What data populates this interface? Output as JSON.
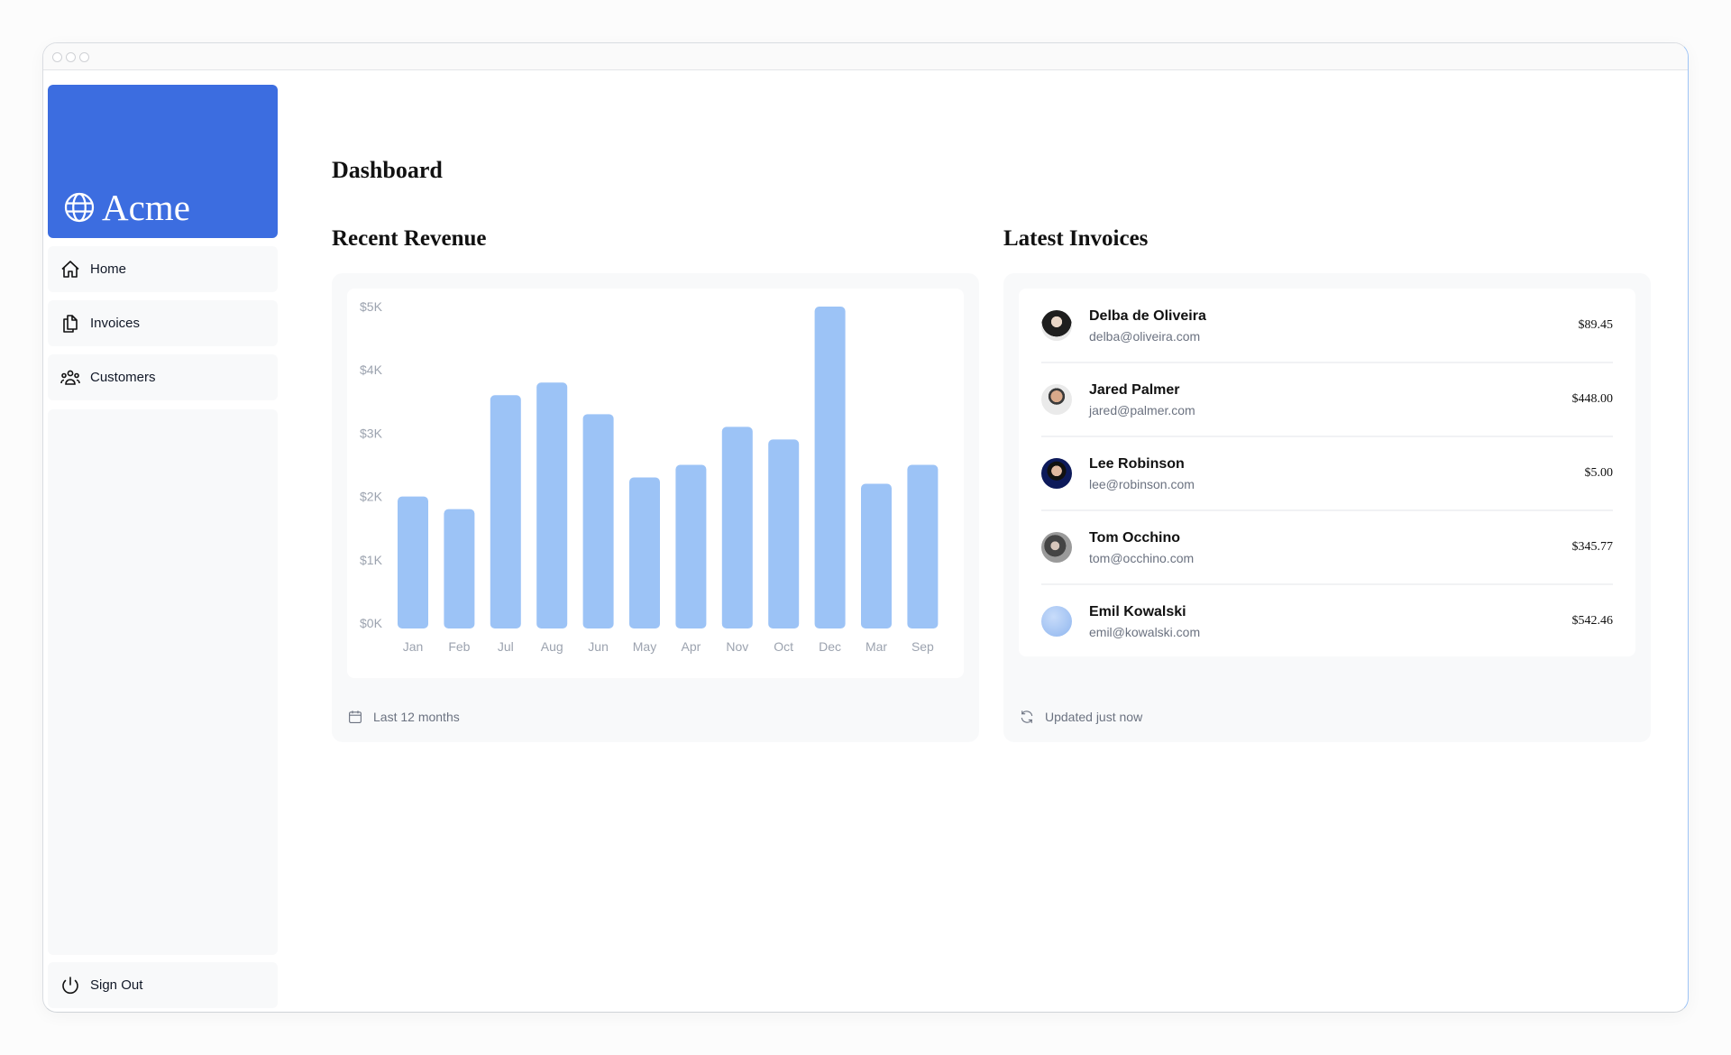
{
  "window": {
    "controls": [
      "close",
      "minimize",
      "maximize"
    ]
  },
  "sidebar": {
    "brand": {
      "name": "Acme",
      "icon": "globe-icon",
      "color": "#3c6de0"
    },
    "items": [
      {
        "label": "Home",
        "icon": "home-icon"
      },
      {
        "label": "Invoices",
        "icon": "document-duplicate-icon"
      },
      {
        "label": "Customers",
        "icon": "user-group-icon"
      }
    ],
    "sign_out": {
      "label": "Sign Out",
      "icon": "power-icon"
    }
  },
  "page": {
    "title": "Dashboard"
  },
  "revenue": {
    "title": "Recent Revenue",
    "footer": {
      "label": "Last 12 months",
      "icon": "calendar-icon"
    }
  },
  "chart_data": {
    "type": "bar",
    "title": "Recent Revenue",
    "xlabel": "",
    "ylabel": "",
    "categories": [
      "Jan",
      "Feb",
      "Jul",
      "Aug",
      "Jun",
      "May",
      "Apr",
      "Nov",
      "Oct",
      "Dec",
      "Mar",
      "Sep"
    ],
    "values": [
      2000,
      1800,
      3600,
      3800,
      3300,
      2300,
      2500,
      3100,
      2900,
      5000,
      2200,
      2500
    ],
    "yticks": [
      "$0K",
      "$1K",
      "$2K",
      "$3K",
      "$4K",
      "$5K"
    ],
    "ylim": [
      0,
      5000
    ],
    "grid": false,
    "bar_color": "#9cc3f6"
  },
  "invoices": {
    "title": "Latest Invoices",
    "rows": [
      {
        "name": "Delba de Oliveira",
        "email": "delba@oliveira.com",
        "amount": "$89.45"
      },
      {
        "name": "Jared Palmer",
        "email": "jared@palmer.com",
        "amount": "$448.00"
      },
      {
        "name": "Lee Robinson",
        "email": "lee@robinson.com",
        "amount": "$5.00"
      },
      {
        "name": "Tom Occhino",
        "email": "tom@occhino.com",
        "amount": "$345.77"
      },
      {
        "name": "Emil Kowalski",
        "email": "emil@kowalski.com",
        "amount": "$542.46"
      }
    ],
    "footer": {
      "label": "Updated just now",
      "icon": "refresh-icon"
    }
  }
}
